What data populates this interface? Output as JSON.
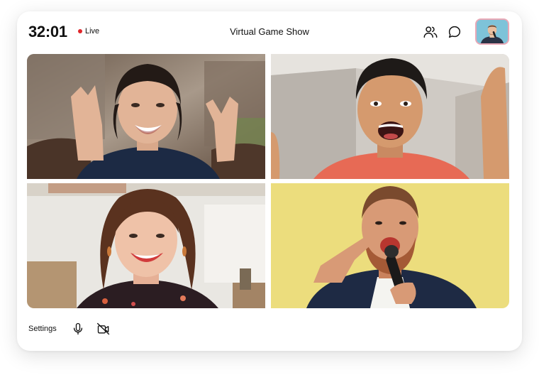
{
  "header": {
    "timer": "32:01",
    "live_label": "Live",
    "title": "Virtual Game Show",
    "icons": [
      "participants-icon",
      "chat-icon"
    ],
    "live_color": "#e0262b"
  },
  "participants": [
    {
      "tile": "participant-tile-1"
    },
    {
      "tile": "participant-tile-2"
    },
    {
      "tile": "participant-tile-3"
    },
    {
      "tile": "participant-tile-4"
    }
  ],
  "footer": {
    "settings_label": "Settings",
    "icons": [
      "microphone-icon",
      "camera-off-icon"
    ]
  }
}
